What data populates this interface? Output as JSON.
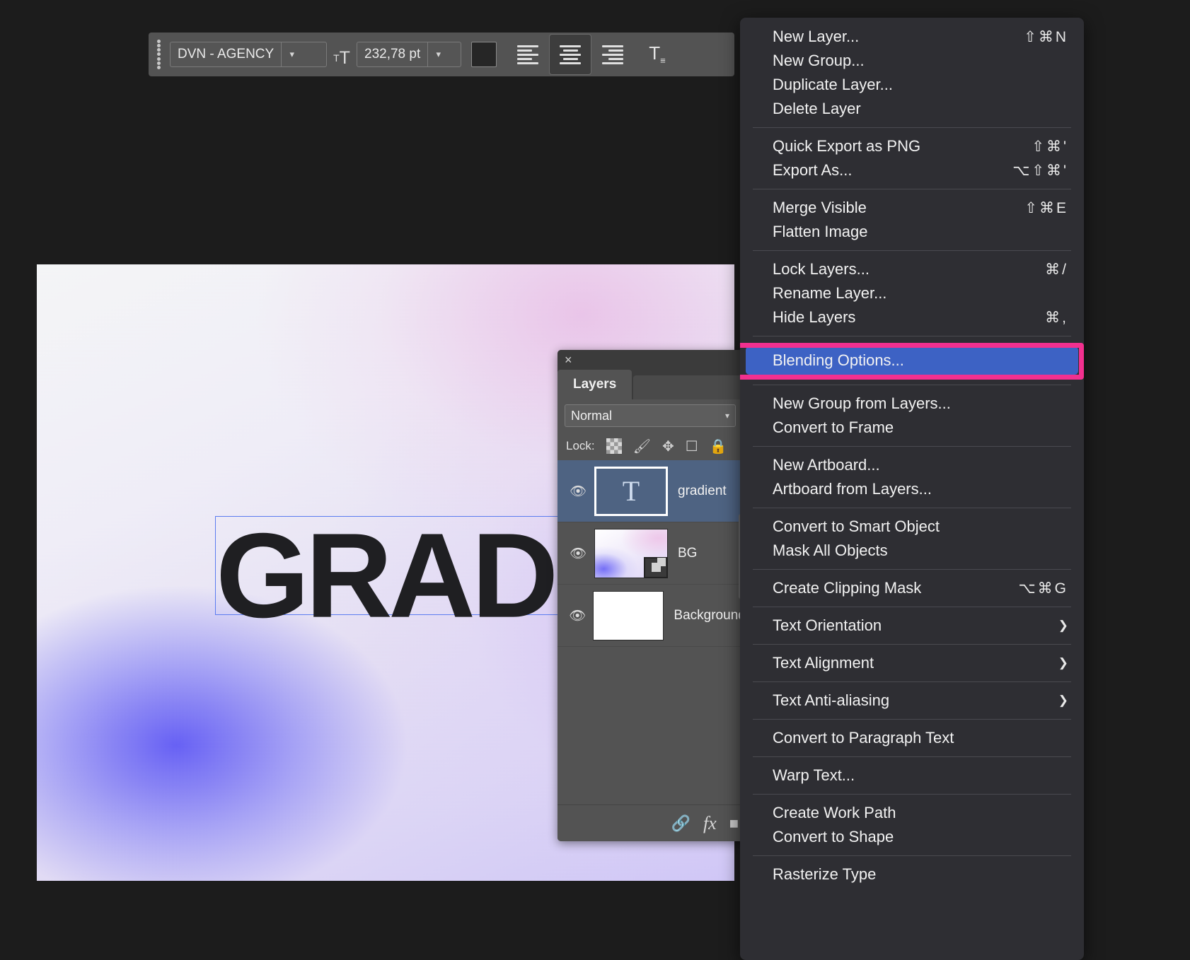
{
  "app": "Adobe Photoshop",
  "options_bar": {
    "font_family": "DVN - AGENCY",
    "font_size": "232,78 pt",
    "size_icon": "font-size-icon",
    "color_swatch": "#262626",
    "align_left_label": "Left align text",
    "align_center_label": "Center text",
    "align_right_label": "Right align text",
    "toggle_panels_label": "Toggle Character and Paragraph panels"
  },
  "canvas": {
    "text": "GRADI",
    "text_color": "#1f1f22"
  },
  "layers_panel": {
    "close_label": "×",
    "tab_label": "Layers",
    "blend_mode": "Normal",
    "blend_caret": "⌄",
    "lock_label": "Lock:",
    "lock_icons": [
      "transparency-lock",
      "brush-lock",
      "move-lock",
      "artboard-lock",
      "all-lock"
    ],
    "rows": [
      {
        "name": "gradient",
        "thumb": "text",
        "visible": true,
        "selected": true
      },
      {
        "name": "BG",
        "thumb": "gradient",
        "visible": true,
        "selected": false,
        "smart_object": true
      },
      {
        "name": "Background",
        "thumb": "white",
        "visible": true,
        "selected": false
      }
    ],
    "footer_icons": [
      "link-icon",
      "fx-icon",
      "mask-icon"
    ]
  },
  "context_menu": {
    "groups": [
      {
        "items": [
          {
            "label": "New Layer...",
            "shortcut": "⇧⌘N"
          },
          {
            "label": "New Group...",
            "shortcut": ""
          },
          {
            "label": "Duplicate Layer...",
            "shortcut": ""
          },
          {
            "label": "Delete Layer",
            "shortcut": ""
          }
        ]
      },
      {
        "items": [
          {
            "label": "Quick Export as PNG",
            "shortcut": "⇧⌘'"
          },
          {
            "label": "Export As...",
            "shortcut": "⌥⇧⌘'"
          }
        ]
      },
      {
        "items": [
          {
            "label": "Merge Visible",
            "shortcut": "⇧⌘E"
          },
          {
            "label": "Flatten Image",
            "shortcut": ""
          }
        ]
      },
      {
        "items": [
          {
            "label": "Lock Layers...",
            "shortcut": "⌘/"
          },
          {
            "label": "Rename Layer...",
            "shortcut": ""
          },
          {
            "label": "Hide Layers",
            "shortcut": "⌘,"
          }
        ]
      },
      {
        "highlighted": true,
        "items": [
          {
            "label": "Blending Options...",
            "shortcut": ""
          }
        ]
      },
      {
        "items": [
          {
            "label": "New Group from Layers...",
            "shortcut": ""
          },
          {
            "label": "Convert to Frame",
            "shortcut": ""
          }
        ]
      },
      {
        "items": [
          {
            "label": "New Artboard...",
            "shortcut": ""
          },
          {
            "label": "Artboard from Layers...",
            "shortcut": ""
          }
        ]
      },
      {
        "items": [
          {
            "label": "Convert to Smart Object",
            "shortcut": ""
          },
          {
            "label": "Mask All Objects",
            "shortcut": ""
          }
        ]
      },
      {
        "items": [
          {
            "label": "Create Clipping Mask",
            "shortcut": "⌥⌘G"
          }
        ]
      },
      {
        "items": [
          {
            "label": "Text Orientation",
            "shortcut": "",
            "submenu": true
          }
        ]
      },
      {
        "items": [
          {
            "label": "Text Alignment",
            "shortcut": "",
            "submenu": true
          }
        ]
      },
      {
        "items": [
          {
            "label": "Text Anti-aliasing",
            "shortcut": "",
            "submenu": true
          }
        ]
      },
      {
        "items": [
          {
            "label": "Convert to Paragraph Text",
            "shortcut": ""
          }
        ]
      },
      {
        "items": [
          {
            "label": "Warp Text...",
            "shortcut": ""
          }
        ]
      },
      {
        "items": [
          {
            "label": "Create Work Path",
            "shortcut": ""
          },
          {
            "label": "Convert to Shape",
            "shortcut": ""
          }
        ]
      },
      {
        "items": [
          {
            "label": "Rasterize Type",
            "shortcut": ""
          }
        ]
      }
    ]
  },
  "colors": {
    "highlight_ring": "#f2308f",
    "menu_selection": "#3d62c4",
    "panel_bg": "#535353",
    "menu_bg": "#2e2e33",
    "app_bg": "#1c1c1c"
  }
}
